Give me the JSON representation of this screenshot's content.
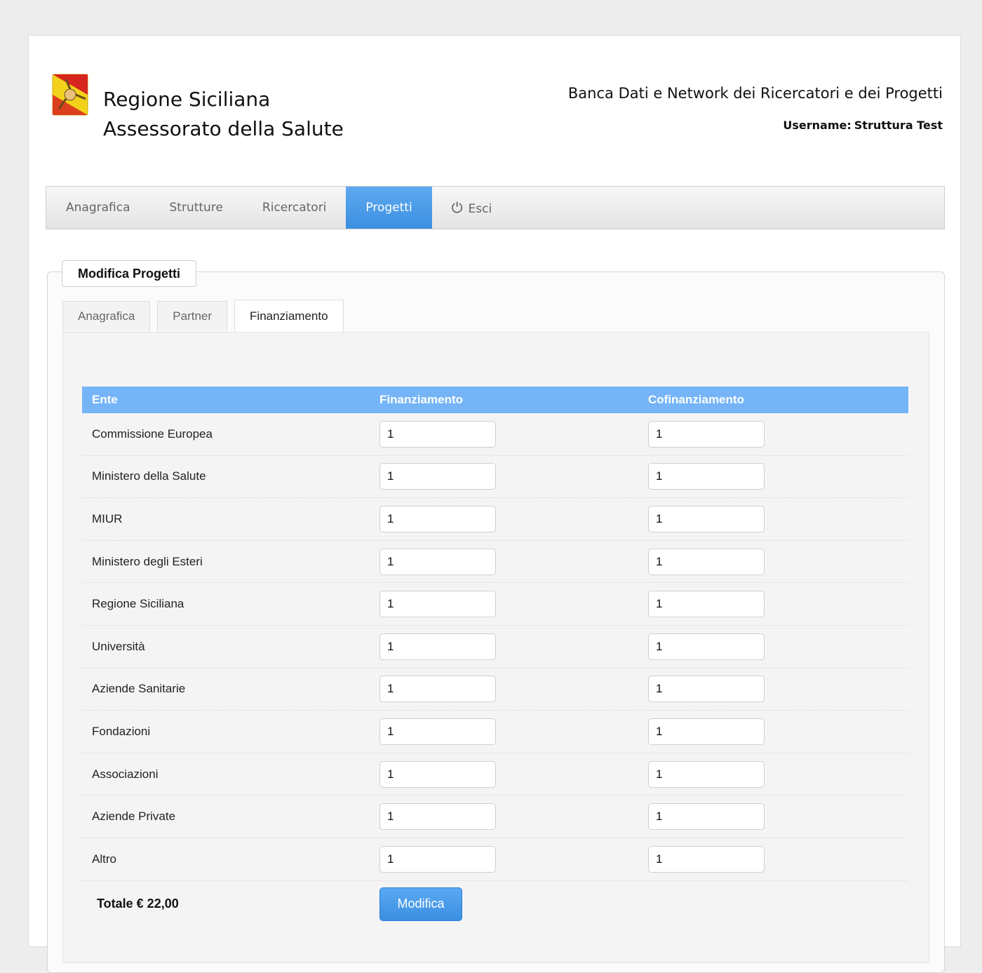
{
  "header": {
    "brand_line1": "Regione Siciliana",
    "brand_line2": "Assessorato della Salute",
    "site_title": "Banca Dati e Network dei Ricercatori e dei Progetti",
    "username_label": "Username:",
    "username_value": "Struttura Test",
    "logo_icon": "trinacria-logo-icon"
  },
  "nav": {
    "items": [
      {
        "label": "Anagrafica"
      },
      {
        "label": "Strutture"
      },
      {
        "label": "Ricercatori"
      },
      {
        "label": "Progetti",
        "active": true
      },
      {
        "label": "Esci",
        "icon": "power-icon"
      }
    ]
  },
  "section": {
    "legend": "Modifica Progetti",
    "tabs": [
      {
        "label": "Anagrafica"
      },
      {
        "label": "Partner"
      },
      {
        "label": "Finanziamento",
        "active": true
      }
    ]
  },
  "table": {
    "headers": {
      "ente": "Ente",
      "finanziamento": "Finanziamento",
      "cofinanziamento": "Cofinanziamento"
    },
    "rows": [
      {
        "ente": "Commissione Europea",
        "finanziamento": "1",
        "cofinanziamento": "1"
      },
      {
        "ente": "Ministero della Salute",
        "finanziamento": "1",
        "cofinanziamento": "1"
      },
      {
        "ente": "MIUR",
        "finanziamento": "1",
        "cofinanziamento": "1"
      },
      {
        "ente": "Ministero degli Esteri",
        "finanziamento": "1",
        "cofinanziamento": "1"
      },
      {
        "ente": "Regione Siciliana",
        "finanziamento": "1",
        "cofinanziamento": "1"
      },
      {
        "ente": "Università",
        "finanziamento": "1",
        "cofinanziamento": "1"
      },
      {
        "ente": "Aziende Sanitarie",
        "finanziamento": "1",
        "cofinanziamento": "1"
      },
      {
        "ente": "Fondazioni",
        "finanziamento": "1",
        "cofinanziamento": "1"
      },
      {
        "ente": "Associazioni",
        "finanziamento": "1",
        "cofinanziamento": "1"
      },
      {
        "ente": "Aziende Private",
        "finanziamento": "1",
        "cofinanziamento": "1"
      },
      {
        "ente": "Altro",
        "finanziamento": "1",
        "cofinanziamento": "1"
      }
    ],
    "totale": "Totale € 22,00",
    "submit_label": "Modifica"
  },
  "colors": {
    "accent": "#3b8fe1",
    "table_header": "#74b4f7"
  }
}
